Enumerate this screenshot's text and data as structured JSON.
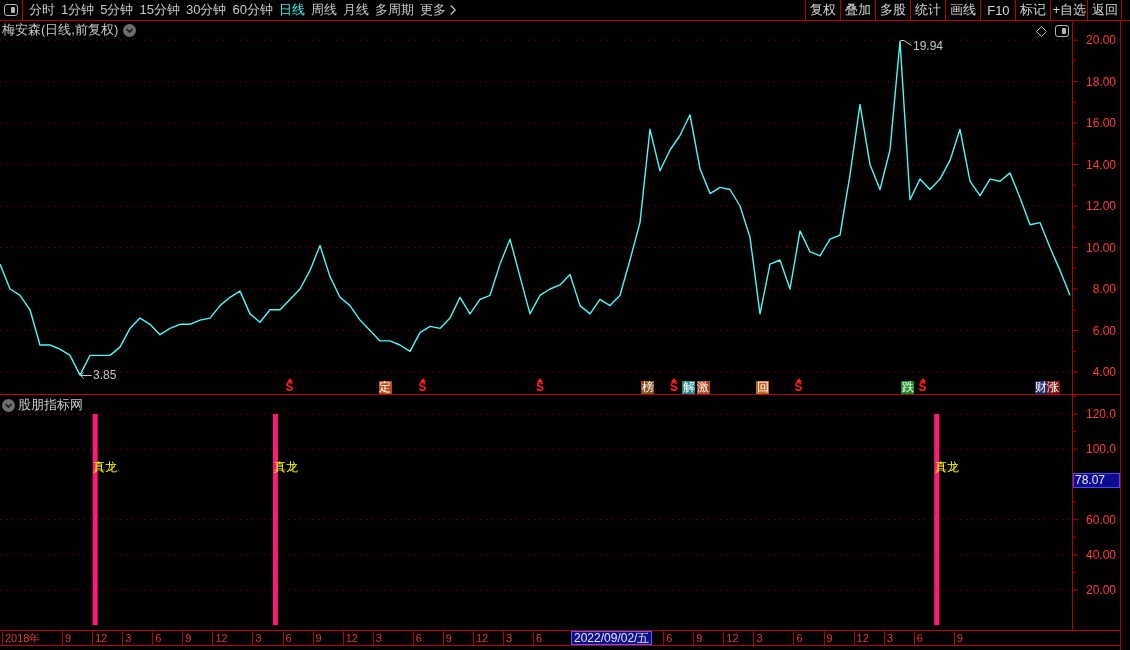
{
  "toolbar": {
    "periods": [
      {
        "kind": "period",
        "label": "分时",
        "selected": false
      },
      {
        "kind": "period",
        "label": "1分钟",
        "selected": false
      },
      {
        "kind": "period",
        "label": "5分钟",
        "selected": false
      },
      {
        "kind": "period",
        "label": "15分钟",
        "selected": false
      },
      {
        "kind": "period",
        "label": "30分钟",
        "selected": false
      },
      {
        "kind": "period",
        "label": "60分钟",
        "selected": false
      },
      {
        "kind": "period",
        "label": "日线",
        "selected": true
      },
      {
        "kind": "period",
        "label": "周线",
        "selected": false
      },
      {
        "kind": "period",
        "label": "月线",
        "selected": false
      },
      {
        "kind": "period",
        "label": "多周期",
        "selected": false
      },
      {
        "kind": "menu",
        "label": "更多",
        "selected": false
      }
    ],
    "buttons": [
      "复权",
      "叠加",
      "多股",
      "统计",
      "画线",
      "F10",
      "标记",
      "+自选",
      "返回"
    ]
  },
  "main_chart": {
    "title": "梅安森(日线,前复权)",
    "chart_data": {
      "type": "line",
      "values": [
        9.2,
        8.0,
        7.7,
        7.0,
        5.3,
        5.3,
        5.1,
        4.8,
        3.85,
        4.8,
        4.8,
        4.8,
        5.2,
        6.1,
        6.6,
        6.3,
        5.8,
        6.1,
        6.3,
        6.3,
        6.5,
        6.6,
        7.2,
        7.6,
        7.9,
        6.8,
        6.4,
        7.0,
        7.0,
        7.5,
        8.0,
        8.9,
        10.1,
        8.6,
        7.6,
        7.2,
        6.5,
        6.0,
        5.5,
        5.5,
        5.3,
        5.0,
        5.9,
        6.2,
        6.1,
        6.6,
        7.6,
        6.8,
        7.5,
        7.7,
        9.2,
        10.4,
        8.6,
        6.8,
        7.7,
        8.0,
        8.2,
        8.7,
        7.2,
        6.8,
        7.5,
        7.2,
        7.7,
        9.4,
        11.2,
        15.7,
        13.7,
        14.7,
        15.4,
        16.4,
        13.8,
        12.6,
        12.9,
        12.8,
        12.0,
        10.5,
        6.8,
        9.2,
        9.4,
        8.0,
        10.8,
        9.8,
        9.6,
        10.4,
        10.6,
        13.5,
        16.9,
        14.0,
        12.8,
        14.7,
        19.94,
        12.3,
        13.3,
        12.8,
        13.3,
        14.2,
        15.7,
        13.2,
        12.5,
        13.3,
        13.2,
        13.6,
        12.4,
        11.1,
        11.2,
        10.0,
        8.9,
        7.7
      ],
      "ylim": [
        2.94,
        20.92
      ],
      "yticks": [
        {
          "value": 4,
          "label": "4.00"
        },
        {
          "value": 6,
          "label": "6.00"
        },
        {
          "value": 8,
          "label": "8.00"
        },
        {
          "value": 10,
          "label": "10.00"
        },
        {
          "value": 12,
          "label": "12.00"
        },
        {
          "value": 14,
          "label": "14.00"
        },
        {
          "value": 16,
          "label": "16.00"
        },
        {
          "value": 18,
          "label": "18.00"
        },
        {
          "value": 20,
          "label": "20.00"
        }
      ],
      "grid": true
    },
    "high_label": "19.94",
    "low_label": "3.85",
    "events": [
      {
        "kind": "signal",
        "label": "S"
      },
      {
        "kind": "tag",
        "label": "定",
        "color": "#b5501e"
      },
      {
        "kind": "signal",
        "label": "S"
      },
      {
        "kind": "signal",
        "label": "S"
      },
      {
        "kind": "tag",
        "label": "榜",
        "color": "#8a4d1c"
      },
      {
        "kind": "signal",
        "label": "S"
      },
      {
        "kind": "tag",
        "label": "解",
        "color": "#1f8a8a"
      },
      {
        "kind": "tag",
        "label": "激",
        "color": "#a8421a"
      },
      {
        "kind": "tag",
        "label": "回",
        "color": "#c8641e"
      },
      {
        "kind": "signal",
        "label": "S"
      },
      {
        "kind": "tag",
        "label": "跌",
        "color": "#1d8a2a"
      },
      {
        "kind": "signal",
        "label": "S"
      },
      {
        "kind": "tag",
        "label": "财",
        "color": "#1e2d6e"
      },
      {
        "kind": "tag",
        "label": "涨",
        "color": "#7a1414"
      }
    ]
  },
  "indicator_chart": {
    "title": "股朋指标网",
    "chart_data": {
      "type": "bar",
      "categories": [
        "2018年",
        null,
        null,
        null,
        null,
        null,
        "9",
        null,
        null,
        "12",
        null,
        null,
        "3",
        null,
        null,
        "6",
        null,
        null,
        "9",
        null,
        null,
        "12",
        null,
        null,
        null,
        "3",
        null,
        null,
        "6",
        null,
        null,
        "9",
        null,
        null,
        "12",
        null,
        null,
        "3",
        null,
        null,
        null,
        "6",
        null,
        null,
        "9",
        null,
        null,
        "12",
        null,
        null,
        "3",
        null,
        null,
        "6",
        null,
        null,
        null,
        null,
        null,
        null,
        null,
        null,
        null,
        null,
        null,
        null,
        "6",
        null,
        null,
        "9",
        null,
        null,
        "12",
        null,
        null,
        "3",
        null,
        null,
        null,
        "6",
        null,
        null,
        "9",
        null,
        null,
        "12",
        null,
        null,
        "3",
        null,
        null,
        "6",
        null,
        null,
        null,
        "9",
        null,
        null,
        null,
        null,
        null,
        null,
        null,
        null,
        null,
        null,
        null
      ],
      "values": [
        null,
        null,
        null,
        null,
        null,
        null,
        null,
        null,
        null,
        120,
        null,
        null,
        null,
        null,
        null,
        null,
        null,
        null,
        null,
        null,
        null,
        null,
        null,
        null,
        null,
        null,
        null,
        120,
        null,
        null,
        null,
        null,
        null,
        null,
        null,
        null,
        null,
        null,
        null,
        null,
        null,
        null,
        null,
        null,
        null,
        null,
        null,
        null,
        null,
        null,
        null,
        null,
        null,
        null,
        null,
        null,
        null,
        null,
        null,
        null,
        null,
        null,
        null,
        null,
        null,
        null,
        null,
        null,
        null,
        null,
        null,
        null,
        null,
        null,
        null,
        null,
        null,
        null,
        null,
        null,
        null,
        null,
        null,
        null,
        null,
        null,
        null,
        null,
        null,
        null,
        null,
        null,
        null,
        120,
        null,
        null,
        null,
        null,
        null,
        null,
        null,
        null,
        null,
        null,
        null,
        null,
        null
      ],
      "value_labels": [
        null,
        null,
        null,
        null,
        null,
        null,
        null,
        null,
        null,
        "真龙",
        null,
        null,
        null,
        null,
        null,
        null,
        null,
        null,
        null,
        null,
        null,
        null,
        null,
        null,
        null,
        null,
        null,
        "真龙",
        null,
        null,
        null,
        null,
        null,
        null,
        null,
        null,
        null,
        null,
        null,
        null,
        null,
        null,
        null,
        null,
        null,
        null,
        null,
        null,
        null,
        null,
        null,
        null,
        null,
        null,
        null,
        null,
        null,
        null,
        null,
        null,
        null,
        null,
        null,
        null,
        null,
        null,
        null,
        null,
        null,
        null,
        null,
        null,
        null,
        null,
        null,
        null,
        null,
        null,
        null,
        null,
        null,
        null,
        null,
        null,
        null,
        null,
        null,
        null,
        null,
        null,
        null,
        null,
        null,
        "真龙",
        null,
        null,
        null,
        null,
        null,
        null,
        null,
        null,
        null,
        null,
        null,
        null,
        null
      ],
      "ylim": [
        -2.73,
        130.8
      ],
      "yticks": [
        {
          "value": 20,
          "label": "20.00"
        },
        {
          "value": 40,
          "label": "40.00"
        },
        {
          "value": 60,
          "label": "60.00"
        },
        {
          "value": 100,
          "label": "100.0"
        },
        {
          "value": 120,
          "label": "120.0"
        }
      ],
      "grid": true
    },
    "value_badge": "78.07",
    "cursor_date": "2022/09/02/五"
  }
}
